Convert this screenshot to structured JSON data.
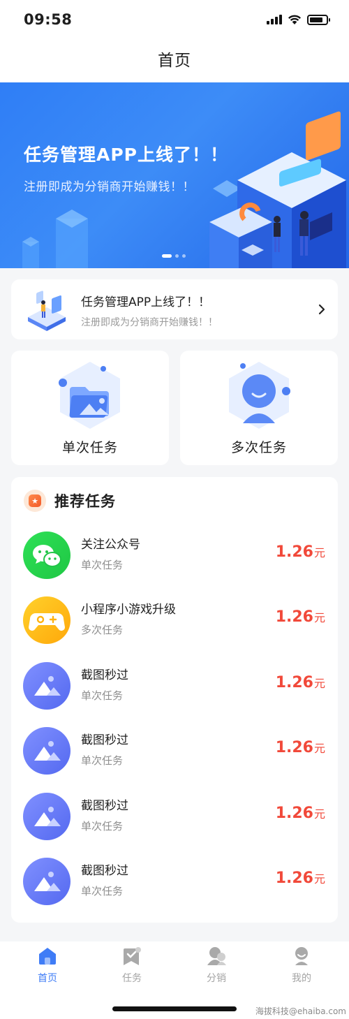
{
  "status_bar": {
    "time": "09:58"
  },
  "nav": {
    "title": "首页"
  },
  "banner": {
    "title": "任务管理APP上线了！！",
    "subtitle": "注册即成为分销商开始赚钱！！",
    "slide_count": 3,
    "active_slide": 1
  },
  "notice": {
    "title": "任务管理APP上线了！！",
    "subtitle": "注册即成为分销商开始赚钱！！",
    "icon": "chevron-right-icon"
  },
  "task_types": {
    "single": "单次任务",
    "multi": "多次任务"
  },
  "recommend": {
    "title": "推荐任务",
    "icon": "star-badge-icon",
    "items": [
      {
        "name": "关注公众号",
        "kind": "单次任务",
        "price": "1.26",
        "unit": "元",
        "icon": "wechat-icon"
      },
      {
        "name": "小程序小游戏升级",
        "kind": "多次任务",
        "price": "1.26",
        "unit": "元",
        "icon": "gamepad-icon"
      },
      {
        "name": "截图秒过",
        "kind": "单次任务",
        "price": "1.26",
        "unit": "元",
        "icon": "image-icon"
      },
      {
        "name": "截图秒过",
        "kind": "单次任务",
        "price": "1.26",
        "unit": "元",
        "icon": "image-icon"
      },
      {
        "name": "截图秒过",
        "kind": "单次任务",
        "price": "1.26",
        "unit": "元",
        "icon": "image-icon"
      },
      {
        "name": "截图秒过",
        "kind": "单次任务",
        "price": "1.26",
        "unit": "元",
        "icon": "image-icon"
      }
    ]
  },
  "tabbar": {
    "items": [
      {
        "label": "首页",
        "icon": "home-icon",
        "active": true
      },
      {
        "label": "任务",
        "icon": "task-icon",
        "active": false
      },
      {
        "label": "分销",
        "icon": "distribution-icon",
        "active": false
      },
      {
        "label": "我的",
        "icon": "profile-icon",
        "active": false
      }
    ]
  },
  "watermark": "海拔科技@ehaiba.com",
  "colors": {
    "primary": "#3f7cf6",
    "price": "#f1493a",
    "background": "#f5f6f8"
  }
}
